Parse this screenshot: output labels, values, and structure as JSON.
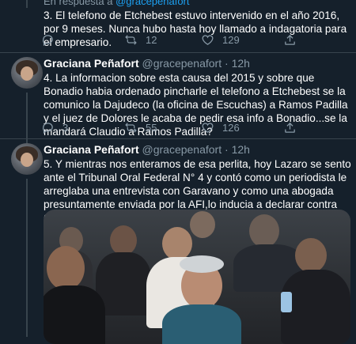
{
  "tweet_prev": {
    "reply_context_prefix": "En respuesta a",
    "reply_context_handle": "@gracepenafort",
    "text": "3. El telefono de Etchebest estuvo intervenido en el año 2016, por 9 meses. Nunca hubo hasta hoy llamado a indagatoria para el empresario.",
    "reply_count": "",
    "retweet_count": "12",
    "like_count": "129"
  },
  "tweet_4": {
    "name": "Graciana Peñafort",
    "handle": "@gracepenafort",
    "dot": "·",
    "time": "12h",
    "text": "4. La informacion sobre esta causa del 2015 y sobre que Bonadio habia ordenado pincharle el telefono a Etchebest se la comunico la Dajudeco (la oficina de Escuchas)  a Ramos Padilla y el juez de Dolores le acaba de pedir esa info a Bonadio...se la mandará Claudio a Ramos Padilla?",
    "reply_count": "3",
    "retweet_count": "55",
    "like_count": "126"
  },
  "tweet_5": {
    "name": "Graciana Peñafort",
    "handle": "@gracepenafort",
    "dot": "·",
    "time": "12h",
    "text": "5. Y mientras nos enteramos de esa perlita, hoy Lazaro se sento ante el Tribunal Oral Federal N° 4 y contó como un periodista le arreglaba una entrevista con Garavano y como una abogada presuntamente enviada por la AFI,lo inducia a declarar contra Cristina"
  },
  "colors": {
    "background": "#15202b",
    "text": "#ffffff",
    "muted": "#8899a6",
    "divider": "#38444d",
    "link": "#1da1f2"
  },
  "icons": [
    "reply-icon",
    "retweet-icon",
    "like-icon",
    "share-icon"
  ]
}
